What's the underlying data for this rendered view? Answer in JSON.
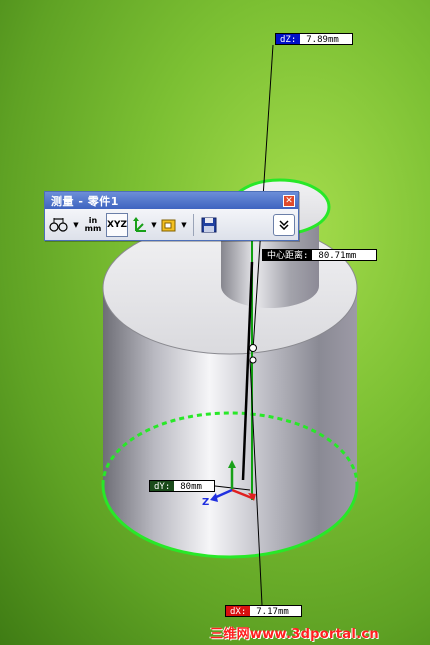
{
  "toolbar": {
    "title": "测量 - 零件1",
    "close_glyph": "✕",
    "units_top": "in",
    "units_bottom": "mm",
    "xyz_label": "XYZ",
    "buttons": [
      {
        "name": "arc-circle-measure-button",
        "icon": "arc-circle-icon",
        "has_dropdown": true
      },
      {
        "name": "units-precision-button",
        "icon": "units-icon",
        "has_dropdown": false
      },
      {
        "name": "xyz-measurements-button",
        "icon": "xyz-icon",
        "has_dropdown": false,
        "pressed": true
      },
      {
        "name": "projection-button",
        "icon": "projection-axis-icon",
        "has_dropdown": true
      },
      {
        "name": "coordinate-system-button",
        "icon": "coordinate-system-icon",
        "has_dropdown": true
      },
      {
        "name": "save-button",
        "icon": "save-icon",
        "has_dropdown": false
      },
      {
        "name": "expand-button",
        "icon": "chevron-double-down-icon",
        "has_dropdown": false
      }
    ]
  },
  "measurements": {
    "dz": {
      "key": "dZ:",
      "value": "7.89mm",
      "color": "#0010c8"
    },
    "center_distance": {
      "key": "中心距离:",
      "value": "80.71mm",
      "color": "#000000"
    },
    "dy": {
      "key": "dY:",
      "value": "80mm",
      "color": "#1a4a1a"
    },
    "dx": {
      "key": "dX:",
      "value": "7.17mm",
      "color": "#d81010"
    }
  },
  "triad": {
    "z_label": "Z"
  },
  "watermark": {
    "text": "三维网www.3dportal.cn"
  },
  "colors": {
    "background": "#7cc033",
    "highlight_edge": "#28e828",
    "measure_line": "#000000"
  }
}
